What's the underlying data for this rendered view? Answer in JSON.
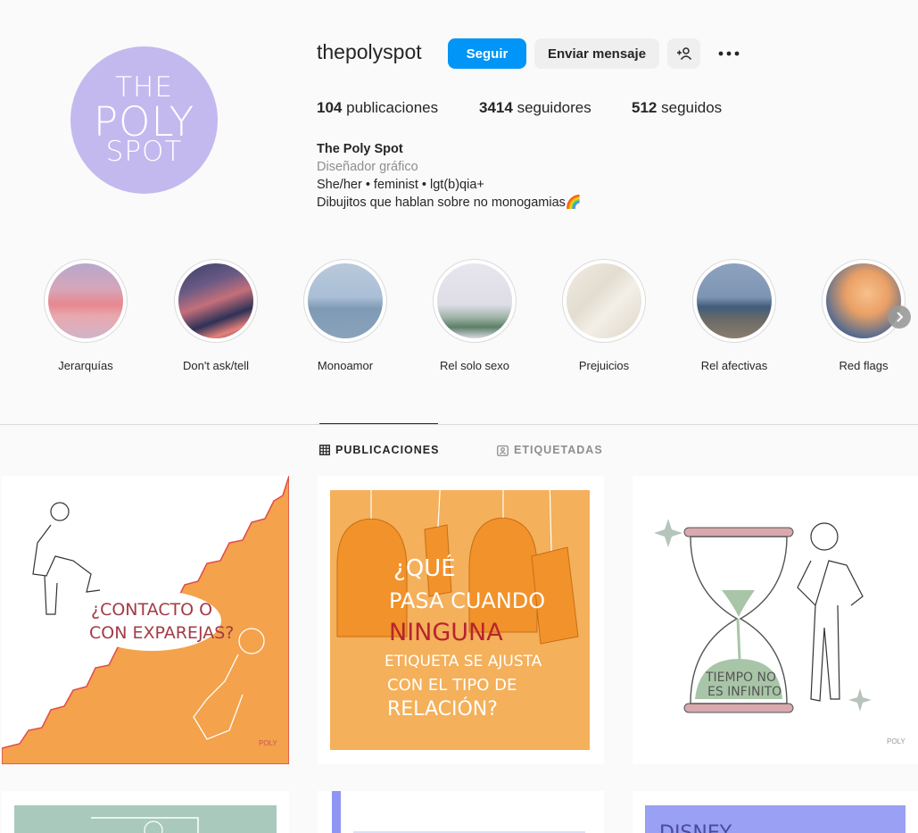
{
  "profile": {
    "username": "thepolyspot",
    "avatar_logo": [
      "THE",
      "POLY",
      "SPOT"
    ],
    "follow_label": "Seguir",
    "message_label": "Enviar mensaje",
    "stats": {
      "posts_count": "104",
      "posts_label": "publicaciones",
      "followers_count": "3414",
      "followers_label": "seguidores",
      "following_count": "512",
      "following_label": "seguidos"
    },
    "bio": {
      "name": "The Poly Spot",
      "category": "Diseñador gráfico",
      "line1": "She/her • feminist • lgt(b)qia+",
      "line2": "Dibujitos que hablan sobre no monogamias🌈"
    }
  },
  "highlights": [
    {
      "label": "Jerarquías"
    },
    {
      "label": "Don't ask/tell"
    },
    {
      "label": "Monoamor"
    },
    {
      "label": "Rel solo sexo"
    },
    {
      "label": "Prejuicios"
    },
    {
      "label": "Rel afectivas"
    },
    {
      "label": "Red flags"
    }
  ],
  "tabs": {
    "posts": "PUBLICACIONES",
    "tagged": "ETIQUETADAS"
  },
  "posts": {
    "p1_text": [
      "¿CONTACTO O",
      "CON EXPAREJAS?"
    ],
    "p2_text": [
      "¿QUÉ",
      "PASA CUANDO",
      "NINGUNA",
      "ETIQUETA SE AJUSTA",
      "CON EL TIPO DE",
      "RELACIÓN?"
    ],
    "p3_text": [
      "TIEMPO NO",
      "ES INFINITO"
    ],
    "p6_text": "DISNEY"
  },
  "colors": {
    "accent": "#0095f6",
    "avatar_bg": "#c3b9ef",
    "orange": "#f4a24c"
  },
  "icons": {
    "suggest": "person-plus-icon",
    "more": "more-horizontal-icon",
    "grid": "grid-icon",
    "tagged": "tag-user-icon",
    "next": "chevron-right-icon"
  }
}
